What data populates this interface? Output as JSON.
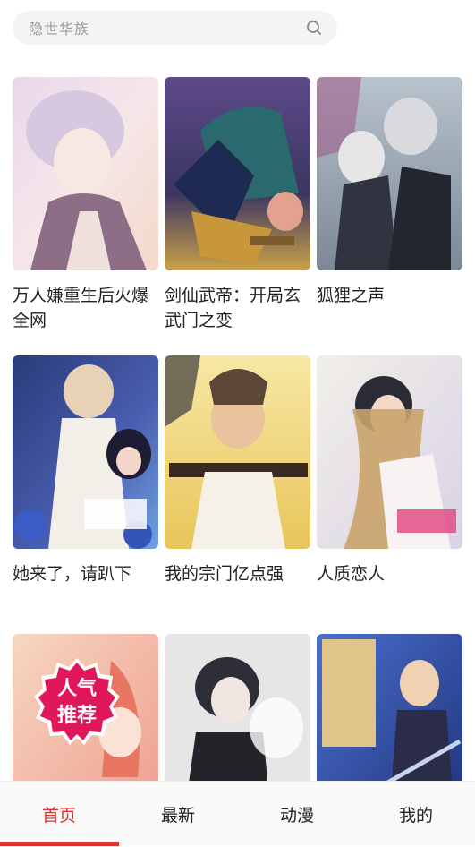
{
  "search": {
    "placeholder": "隐世华族"
  },
  "comics": [
    {
      "title": "万人嫌重生后火爆全网"
    },
    {
      "title": "剑仙武帝：开局玄武门之变"
    },
    {
      "title": "狐狸之声"
    },
    {
      "title": "她来了，请趴下"
    },
    {
      "title": "我的宗门亿点强"
    },
    {
      "title": "人质恋人"
    },
    {
      "title": "",
      "badge": "人气推荐"
    },
    {
      "title": ""
    },
    {
      "title": ""
    }
  ],
  "tabs": [
    {
      "label": "首页",
      "active": true
    },
    {
      "label": "最新",
      "active": false
    },
    {
      "label": "动漫",
      "active": false
    },
    {
      "label": "我的",
      "active": false
    }
  ],
  "colors": {
    "accent": "#d9332b",
    "badge": "#e0185a"
  }
}
